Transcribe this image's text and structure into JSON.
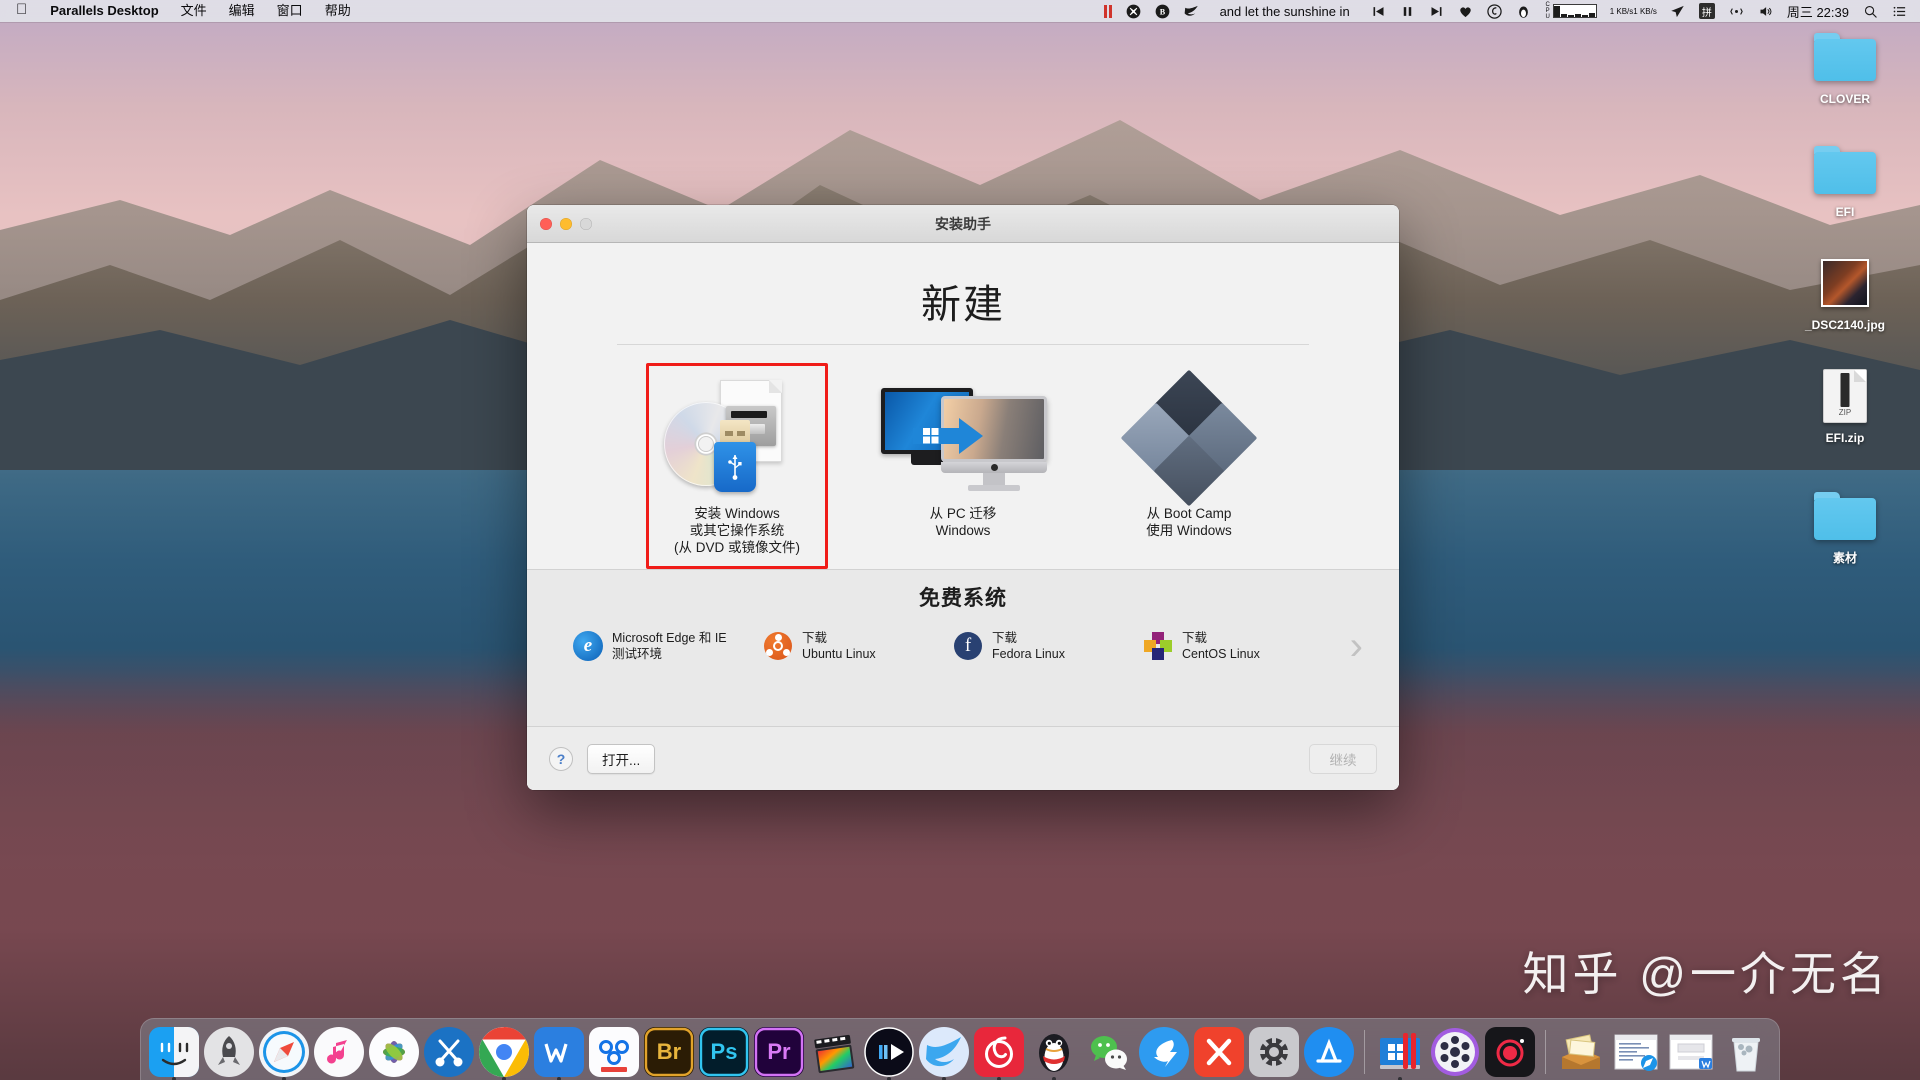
{
  "menubar": {
    "apple_icon": "apple-logo",
    "app_name": "Parallels Desktop",
    "menus": [
      "文件",
      "编辑",
      "窗口",
      "帮助"
    ],
    "status_right": {
      "pause_icon": "pause-icon",
      "xmind_icon": "x-circle-icon",
      "bartender_icon": "bartender-icon",
      "swallow_icon": "swallow-icon",
      "now_playing": "and let the sunshine in",
      "prev_icon": "previous-track-icon",
      "pause2_icon": "pause-track-icon",
      "next_icon": "next-track-icon",
      "heart_icon": "heart-icon",
      "netease_icon": "netease-music-icon",
      "penguin_icon": "penguin-icon",
      "cpu_label": "CPU",
      "net_up": "1 KB/s",
      "net_down": "1 KB/s",
      "telegram_icon": "paper-plane-icon",
      "ime_label": "拼",
      "bluetooth_icon": "airdrop-icon",
      "volume_icon": "volume-icon",
      "clock": "周三 22:39",
      "search_icon": "search-icon",
      "control_center_icon": "list-icon"
    }
  },
  "desktop_icons": [
    {
      "name": "CLOVER",
      "type": "folder"
    },
    {
      "name": "EFI",
      "type": "folder"
    },
    {
      "name": "_DSC2140.jpg",
      "type": "image"
    },
    {
      "name": "EFI.zip",
      "type": "zip",
      "badge": "ZIP"
    },
    {
      "name": "素材",
      "type": "folder"
    }
  ],
  "window": {
    "title": "安装助手",
    "heading": "新建",
    "traffic_lights": [
      "close-button",
      "minimize-button",
      "zoom-button"
    ],
    "options": [
      {
        "id": "install-windows",
        "icon": "dvd-usb-image-icon",
        "lines": [
          "安装 Windows",
          "或其它操作系统",
          "(从 DVD 或镜像文件)"
        ],
        "selected": true
      },
      {
        "id": "transfer-from-pc",
        "icon": "pc-to-mac-transfer-icon",
        "lines": [
          "从 PC 迁移",
          "Windows"
        ],
        "selected": false
      },
      {
        "id": "use-boot-camp",
        "icon": "boot-camp-diamonds-icon",
        "lines": [
          "从 Boot Camp",
          "使用 Windows"
        ],
        "selected": false
      }
    ],
    "free_systems": {
      "title": "免费系统",
      "items": [
        {
          "icon": "edge-icon",
          "line1": "Microsoft Edge 和 IE",
          "line2": "测试环境"
        },
        {
          "icon": "ubuntu-icon",
          "line1": "下载",
          "line2": "Ubuntu Linux"
        },
        {
          "icon": "fedora-icon",
          "line1": "下载",
          "line2": "Fedora Linux"
        },
        {
          "icon": "centos-icon",
          "line1": "下载",
          "line2": "CentOS Linux"
        }
      ],
      "next_arrow": "chevron-right-icon"
    },
    "footer": {
      "help_label": "?",
      "open_label": "打开...",
      "continue_label": "继续",
      "continue_disabled": true
    }
  },
  "watermark": "知乎 @一介无名",
  "dock": {
    "items": [
      {
        "name": "finder",
        "label": "finder-icon",
        "running": true
      },
      {
        "name": "launchpad",
        "label": "launchpad-icon",
        "running": false
      },
      {
        "name": "safari",
        "label": "safari-icon",
        "running": true
      },
      {
        "name": "music",
        "label": "music-icon",
        "running": false
      },
      {
        "name": "photos",
        "label": "photos-icon",
        "running": false
      },
      {
        "name": "snipaste",
        "label": "scissors-icon",
        "running": false
      },
      {
        "name": "chrome",
        "label": "chrome-icon",
        "running": true
      },
      {
        "name": "wps",
        "label": "wps-icon",
        "running": true
      },
      {
        "name": "creative-cloud",
        "label": "creative-cloud-icon",
        "running": false
      },
      {
        "name": "bridge",
        "label": "Br",
        "running": false
      },
      {
        "name": "photoshop",
        "label": "Ps",
        "running": false
      },
      {
        "name": "premiere",
        "label": "Pr",
        "running": false
      },
      {
        "name": "final-cut-pro",
        "label": "final-cut-icon",
        "running": false
      },
      {
        "name": "iina",
        "label": "iina-icon",
        "running": true
      },
      {
        "name": "bird-player",
        "label": "bird-icon",
        "running": true
      },
      {
        "name": "netease-music",
        "label": "netease-icon",
        "running": true
      },
      {
        "name": "qq",
        "label": "qq-penguin-icon",
        "running": true
      },
      {
        "name": "wechat",
        "label": "wechat-icon",
        "running": false
      },
      {
        "name": "dingtalk",
        "label": "dingtalk-icon",
        "running": false
      },
      {
        "name": "xmind",
        "label": "xmind-icon",
        "running": false
      },
      {
        "name": "system-preferences",
        "label": "gear-icon",
        "running": false
      },
      {
        "name": "app-store",
        "label": "app-store-icon",
        "running": false
      },
      {
        "name": "parallels-desktop",
        "label": "parallels-icon",
        "running": true
      },
      {
        "name": "video-player",
        "label": "film-reel-icon",
        "running": false
      },
      {
        "name": "screen-recorder",
        "label": "record-icon",
        "running": false
      },
      {
        "name": "downloads-stack",
        "label": "downloads-icon",
        "running": false
      },
      {
        "name": "minimized-safari",
        "label": "minimized-window-safari",
        "running": false
      },
      {
        "name": "minimized-wps",
        "label": "minimized-window-wps",
        "running": false
      },
      {
        "name": "trash",
        "label": "trash-icon",
        "running": false
      }
    ],
    "separator": "dock-separator"
  }
}
